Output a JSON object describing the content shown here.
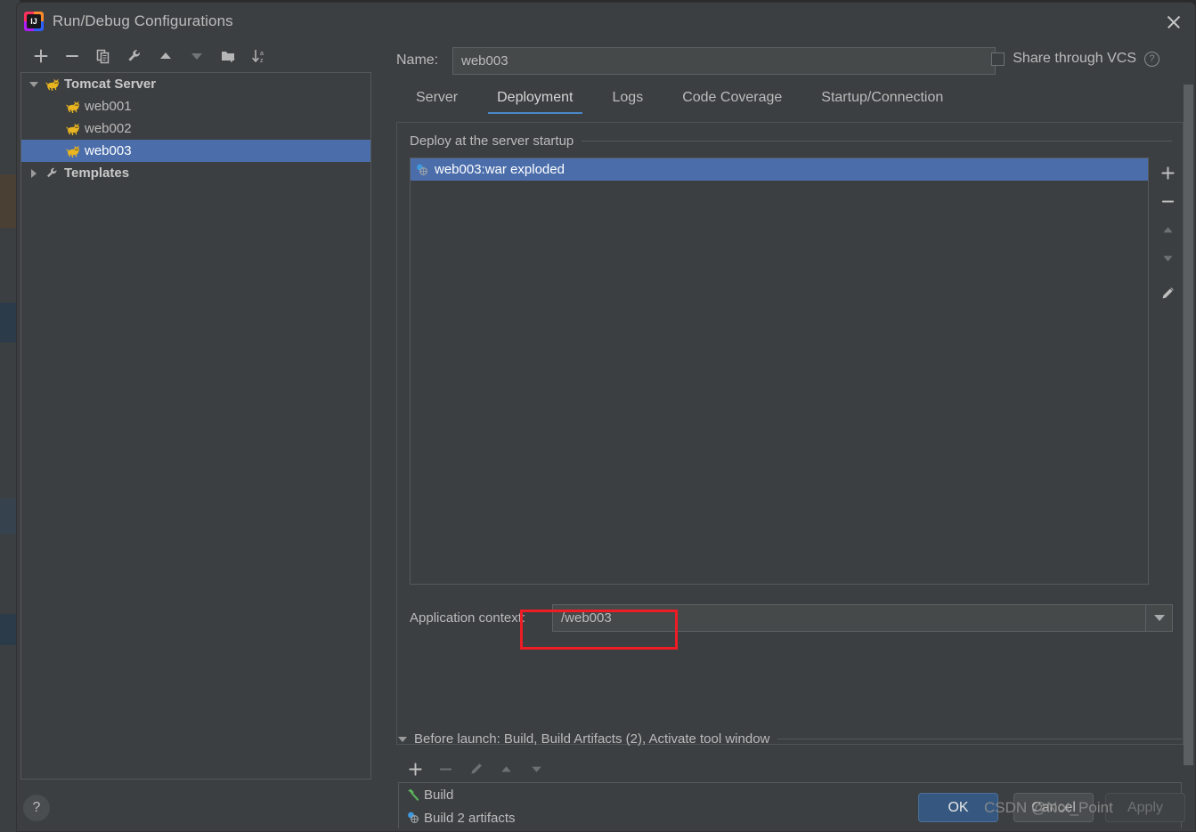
{
  "window": {
    "title": "Run/Debug Configurations",
    "app_logo_text": "IJ",
    "close_icon": "close-icon"
  },
  "tree_toolbar": [
    {
      "name": "add-configuration-button",
      "icon": "plus-icon",
      "enabled": true
    },
    {
      "name": "remove-configuration-button",
      "icon": "minus-icon",
      "enabled": true
    },
    {
      "name": "copy-configuration-button",
      "icon": "copy-icon",
      "enabled": true
    },
    {
      "name": "edit-templates-button",
      "icon": "wrench-icon",
      "enabled": true
    },
    {
      "name": "move-up-button",
      "icon": "arrow-up-icon",
      "enabled": true
    },
    {
      "name": "move-down-button",
      "icon": "arrow-down-icon",
      "enabled": false
    },
    {
      "name": "new-folder-button",
      "icon": "folder-add-icon",
      "enabled": true
    },
    {
      "name": "sort-configurations-button",
      "icon": "sort-az-icon",
      "enabled": true
    }
  ],
  "tree": {
    "items": [
      {
        "label": "Tomcat Server",
        "level": 0,
        "expanded": true,
        "icon": "tomcat-icon",
        "selected": false
      },
      {
        "label": "web001",
        "level": 1,
        "icon": "tomcat-icon",
        "selected": false
      },
      {
        "label": "web002",
        "level": 1,
        "icon": "tomcat-icon",
        "selected": false
      },
      {
        "label": "web003",
        "level": 1,
        "icon": "tomcat-icon",
        "selected": true
      },
      {
        "label": "Templates",
        "level": 0,
        "expanded": false,
        "icon": "wrench-icon",
        "selected": false
      }
    ]
  },
  "name_field": {
    "label": "Name:",
    "value": "web003",
    "placeholder": ""
  },
  "share_vcs": {
    "label": "Share through VCS",
    "checked": false,
    "help_icon": "help-icon",
    "help_glyph": "?"
  },
  "tabs": [
    {
      "label": "Server",
      "active": false
    },
    {
      "label": "Deployment",
      "active": true
    },
    {
      "label": "Logs",
      "active": false
    },
    {
      "label": "Code Coverage",
      "active": false
    },
    {
      "label": "Startup/Connection",
      "active": false
    }
  ],
  "deployment": {
    "group_title": "Deploy at the server startup",
    "artifacts": [
      {
        "label": "web003:war exploded",
        "icon": "artifact-icon",
        "selected": true
      }
    ],
    "side_buttons": [
      {
        "name": "add-artifact-button",
        "icon": "plus-icon",
        "enabled": true
      },
      {
        "name": "remove-artifact-button",
        "icon": "minus-icon",
        "enabled": true
      },
      {
        "name": "move-artifact-up-button",
        "icon": "arrow-up-icon",
        "enabled": false
      },
      {
        "name": "move-artifact-down-button",
        "icon": "arrow-down-icon",
        "enabled": false
      },
      {
        "name": "edit-artifact-button",
        "icon": "pencil-icon",
        "enabled": true
      }
    ],
    "application_context": {
      "label": "Application context:",
      "value": "/web003",
      "dropdown_icon": "chevron-down-icon"
    }
  },
  "before_launch": {
    "group_title": "Before launch: Build, Build Artifacts (2), Activate tool window",
    "toolbar": [
      {
        "name": "add-task-button",
        "icon": "plus-icon",
        "enabled": true
      },
      {
        "name": "remove-task-button",
        "icon": "minus-icon",
        "enabled": false
      },
      {
        "name": "edit-task-button",
        "icon": "pencil-icon",
        "enabled": false
      },
      {
        "name": "move-task-up-button",
        "icon": "arrow-up-icon",
        "enabled": false
      },
      {
        "name": "move-task-down-button",
        "icon": "arrow-down-icon",
        "enabled": false
      }
    ],
    "tasks": [
      {
        "label": "Build",
        "icon": "hammer-icon"
      },
      {
        "label": "Build 2 artifacts",
        "icon": "artifact-icon"
      }
    ]
  },
  "footer": {
    "help_glyph": "?",
    "ok_label": "OK",
    "cancel_label": "Cancel",
    "apply_label": "Apply"
  },
  "watermark": {
    "text": "CSDN @Not_Point"
  },
  "colors": {
    "dialog_bg": "#3c3f41",
    "selection_blue": "#4b6eab",
    "tab_accent": "#4a88c7",
    "ok_button": "#365880",
    "annotation_red": "#ee1c24",
    "text_primary": "#bbbbbb"
  }
}
